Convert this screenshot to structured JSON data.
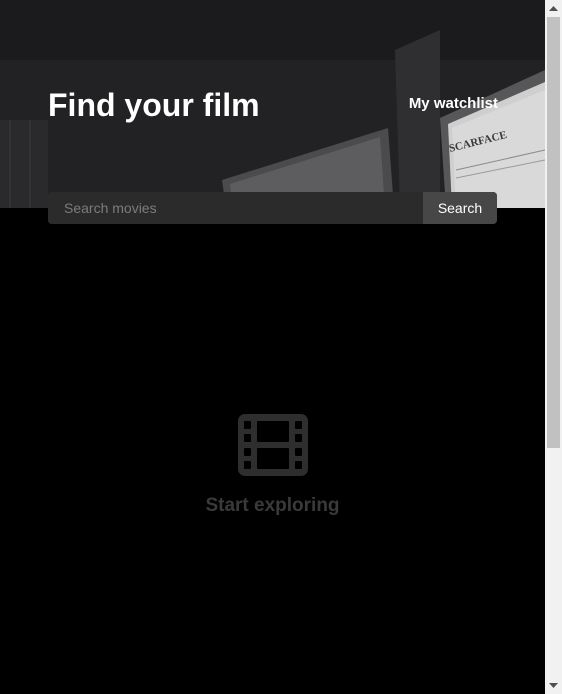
{
  "header": {
    "title": "Find your film",
    "watchlist_label": "My watchlist"
  },
  "search": {
    "placeholder": "Search movies",
    "value": "",
    "button_label": "Search"
  },
  "empty_state": {
    "icon": "film-icon",
    "text": "Start exploring"
  },
  "hero": {
    "background_poster_text": "SCARFACE"
  },
  "colors": {
    "page_background": "#000000",
    "hero_background": "#242426",
    "search_input_bg": "#2b2b2b",
    "search_button_bg": "#474747",
    "empty_state_color": "#3a3a3a",
    "title_color": "#ffffff"
  }
}
